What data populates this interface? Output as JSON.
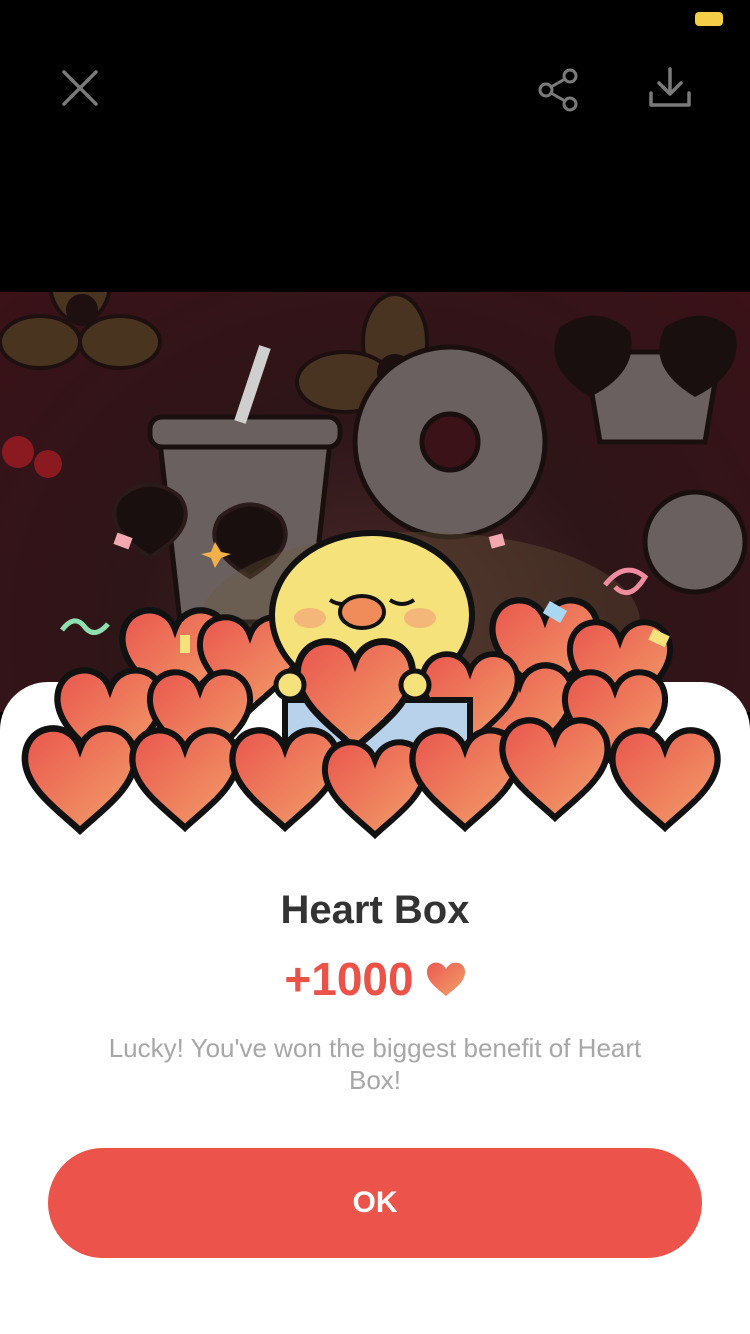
{
  "status_bar": {
    "battery_color": "#f5cd46"
  },
  "toolbar": {
    "close_icon": "close-icon",
    "share_icon": "share-icon",
    "download_icon": "download-icon"
  },
  "dialog": {
    "title": "Heart Box",
    "reward_amount": "+1000",
    "reward_icon": "heart-icon",
    "message": "Lucky! You've won the biggest benefit of Heart Box!",
    "ok_label": "OK"
  },
  "colors": {
    "accent": "#ec534a",
    "title": "#333333",
    "message": "#a7a7a7"
  }
}
